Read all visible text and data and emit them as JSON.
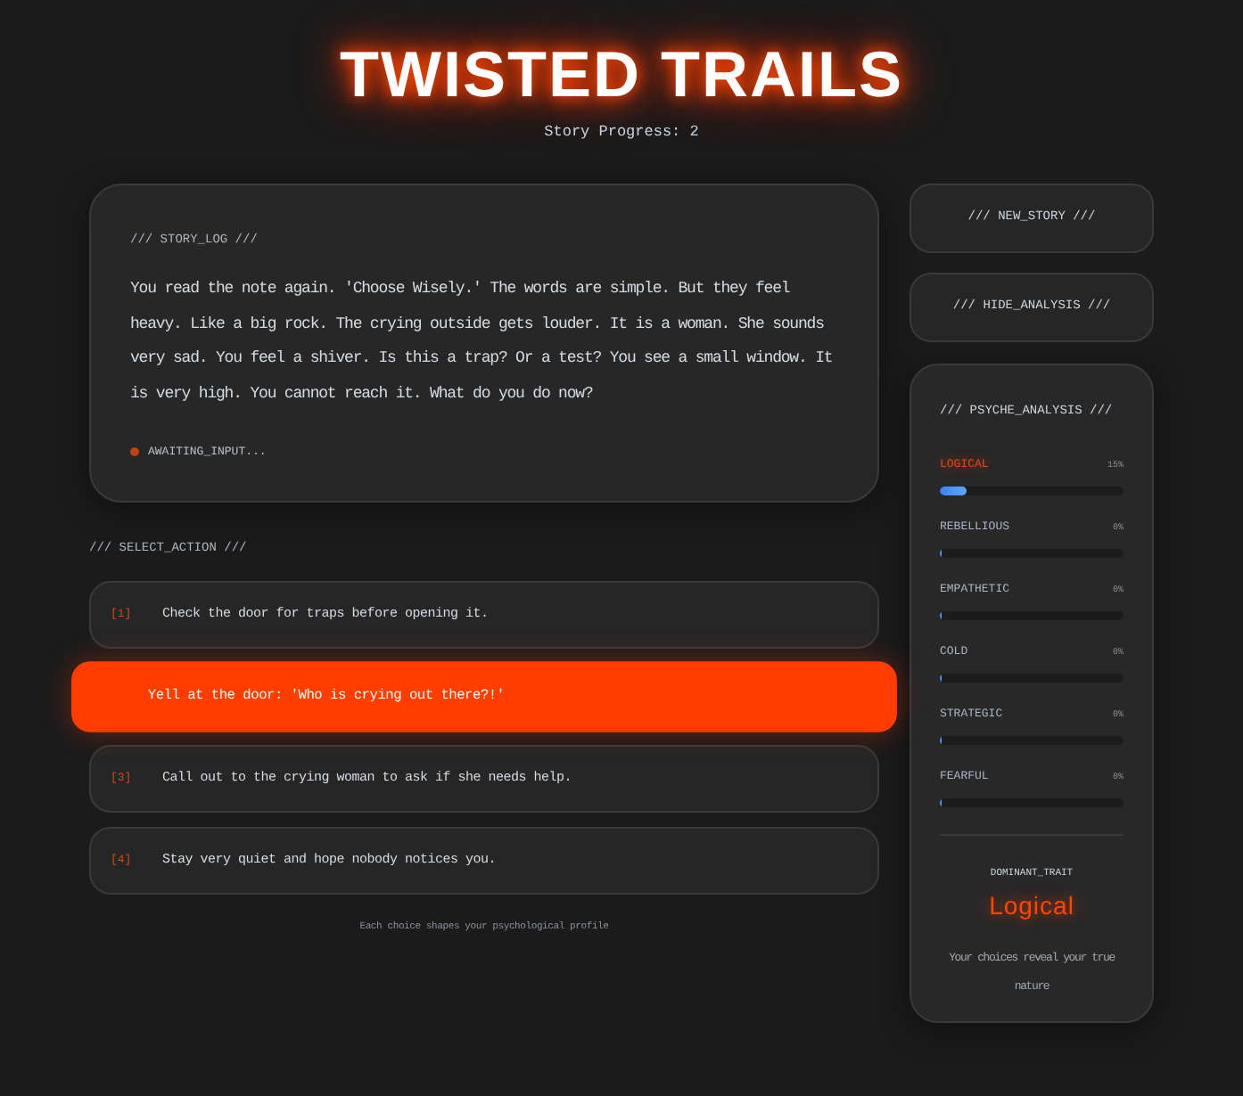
{
  "header": {
    "title": "TWISTED TRAILS",
    "progress": "Story Progress: 2"
  },
  "story_log": {
    "heading": "/// STORY_LOG ///",
    "text": "You read the note again. 'Choose Wisely.' The words are simple. But they feel heavy. Like a big rock. The crying outside gets louder. It is a woman. She sounds very sad. You feel a shiver. Is this a trap? Or a test? You see a small window. It is very high. You cannot reach it. What do you do now?",
    "status": "AWAITING_INPUT..."
  },
  "actions": {
    "heading": "/// SELECT_ACTION ///",
    "choices": [
      {
        "number": "[1]",
        "text": "Check the door for traps before opening it.",
        "selected": false
      },
      {
        "text": "Yell at the door: 'Who is crying out there?!'",
        "selected": true
      },
      {
        "number": "[3]",
        "text": "Call out to the crying woman to ask if she needs help.",
        "selected": false
      },
      {
        "number": "[4]",
        "text": "Stay very quiet and hope nobody notices you.",
        "selected": false
      }
    ],
    "footer": "Each choice shapes your psychological profile"
  },
  "sidebar": {
    "buttons": [
      "/// NEW_STORY ///",
      "/// HIDE_ANALYSIS ///"
    ],
    "analysis": {
      "heading": "/// PSYCHE_ANALYSIS ///",
      "traits": [
        {
          "label": "LOGICAL",
          "reading": "15%",
          "level": 0.15,
          "dominant": true
        },
        {
          "label": "REBELLIOUS",
          "reading": "0%",
          "level": 0,
          "dominant": false
        },
        {
          "label": "EMPATHETIC",
          "reading": "0%",
          "level": 0,
          "dominant": false
        },
        {
          "label": "COLD",
          "reading": "0%",
          "level": 0,
          "dominant": false
        },
        {
          "label": "STRATEGIC",
          "reading": "0%",
          "level": 0,
          "dominant": false
        },
        {
          "label": "FEARFUL",
          "reading": "0%",
          "level": 0,
          "dominant": false
        }
      ],
      "dominant_label": "DOMINANT_TRAIT",
      "dominant_value": "Logical",
      "note": "Your choices reveal your true nature"
    }
  }
}
